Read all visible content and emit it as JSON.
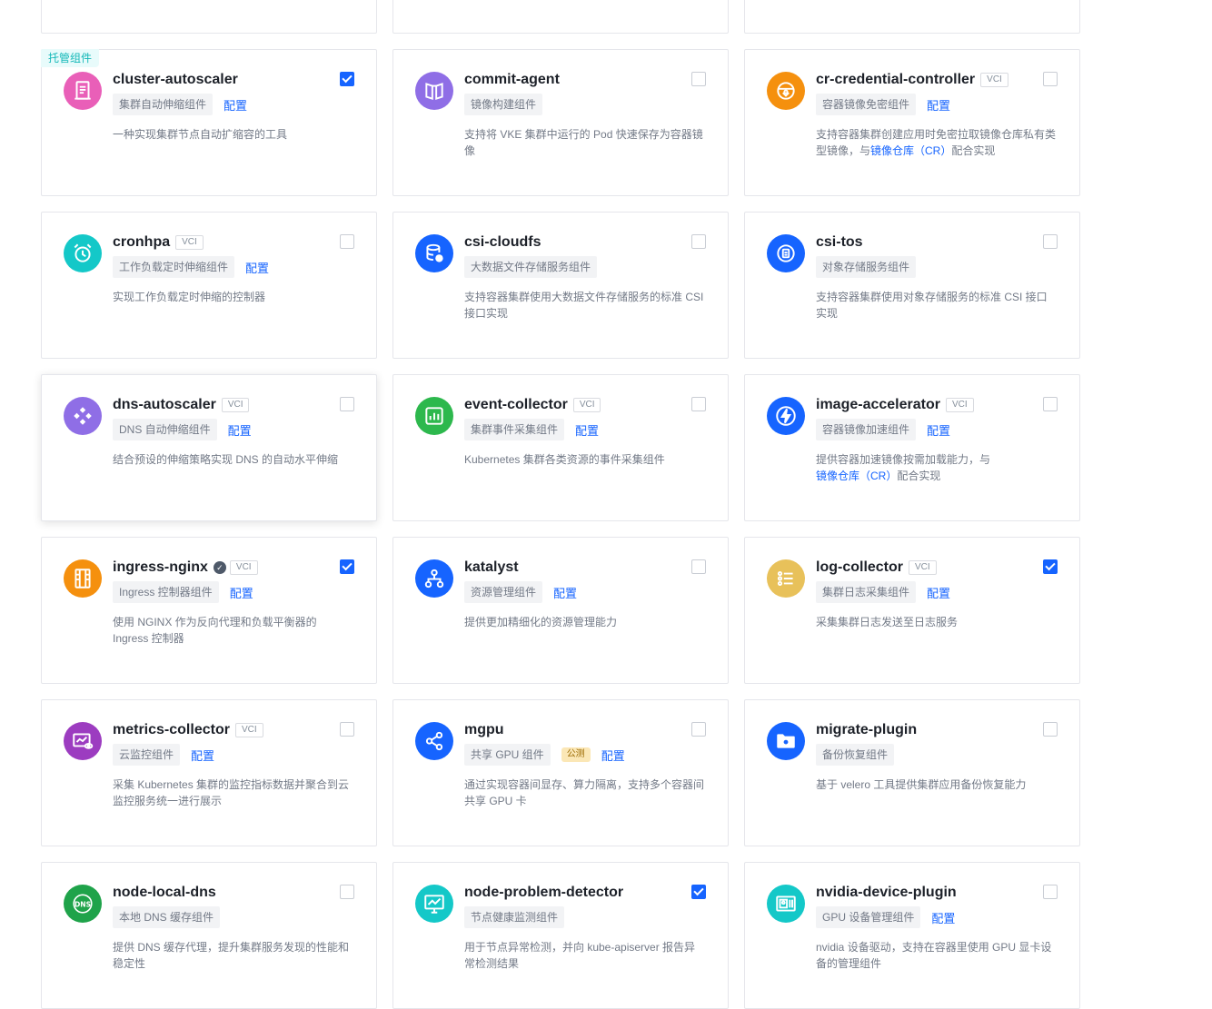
{
  "managed_tag": "托管组件",
  "vci_label": "VCI",
  "config_label": "配置",
  "cards": [
    {
      "title": "cluster-autoscaler",
      "vci": false,
      "verified": false,
      "tag": "集群自动伸缩组件",
      "beta": "",
      "config": true,
      "checked": true,
      "managed": true,
      "desc": "一种实现集群节点自动扩缩容的工具",
      "desc_link": "",
      "desc_after": "",
      "icon": "document-icon",
      "color": "#e95fb8",
      "hovered": false
    },
    {
      "title": "commit-agent",
      "vci": false,
      "verified": false,
      "tag": "镜像构建组件",
      "beta": "",
      "config": false,
      "checked": false,
      "managed": false,
      "desc": "支持将 VKE 集群中运行的 Pod 快速保存为容器镜像",
      "desc_link": "",
      "desc_after": "",
      "icon": "book-icon",
      "color": "#8f6ee6",
      "hovered": false
    },
    {
      "title": "cr-credential-controller",
      "vci": true,
      "verified": false,
      "tag": "容器镜像免密组件",
      "beta": "",
      "config": true,
      "checked": false,
      "managed": false,
      "desc": "支持容器集群创建应用时免密拉取镜像仓库私有类型镜像，与",
      "desc_link": "镜像仓库（CR）",
      "desc_after": "配合实现",
      "icon": "steering-icon",
      "color": "#f5900e",
      "hovered": false
    },
    {
      "title": "cronhpa",
      "vci": true,
      "verified": false,
      "tag": "工作负载定时伸缩组件",
      "beta": "",
      "config": true,
      "checked": false,
      "managed": false,
      "desc": "实现工作负载定时伸缩的控制器",
      "desc_link": "",
      "desc_after": "",
      "icon": "alarm-clock-icon",
      "color": "#14c8c8",
      "hovered": false
    },
    {
      "title": "csi-cloudfs",
      "vci": false,
      "verified": false,
      "tag": "大数据文件存储服务组件",
      "beta": "",
      "config": false,
      "checked": false,
      "managed": false,
      "desc": "支持容器集群使用大数据文件存储服务的标准 CSI 接口实现",
      "desc_link": "",
      "desc_after": "",
      "icon": "database-icon",
      "color": "#1664ff",
      "hovered": false
    },
    {
      "title": "csi-tos",
      "vci": false,
      "verified": false,
      "tag": "对象存储服务组件",
      "beta": "",
      "config": false,
      "checked": false,
      "managed": false,
      "desc": "支持容器集群使用对象存储服务的标准 CSI 接口实现",
      "desc_link": "",
      "desc_after": "",
      "icon": "object-storage-icon",
      "color": "#1664ff",
      "hovered": false
    },
    {
      "title": "dns-autoscaler",
      "vci": true,
      "verified": false,
      "tag": "DNS 自动伸缩组件",
      "beta": "",
      "config": true,
      "checked": false,
      "managed": false,
      "desc": "结合预设的伸缩策略实现 DNS 的自动水平伸缩",
      "desc_link": "",
      "desc_after": "",
      "icon": "diamond-grid-icon",
      "color": "#8f6ee6",
      "hovered": true
    },
    {
      "title": "event-collector",
      "vci": true,
      "verified": false,
      "tag": "集群事件采集组件",
      "beta": "",
      "config": true,
      "checked": false,
      "managed": false,
      "desc": "Kubernetes 集群各类资源的事件采集组件",
      "desc_link": "",
      "desc_after": "",
      "icon": "chart-board-icon",
      "color": "#2db84d",
      "hovered": false
    },
    {
      "title": "image-accelerator",
      "vci": true,
      "verified": false,
      "tag": "容器镜像加速组件",
      "beta": "",
      "config": true,
      "checked": false,
      "managed": false,
      "desc": "提供容器加速镜像按需加载能力，与",
      "desc_link": "镜像仓库（CR）",
      "desc_after": "配合实现",
      "icon": "lightning-icon",
      "color": "#1664ff",
      "hovered": false
    },
    {
      "title": "ingress-nginx",
      "vci": true,
      "verified": true,
      "tag": "Ingress 控制器组件",
      "beta": "",
      "config": true,
      "checked": true,
      "managed": false,
      "desc": "使用 NGINX 作为反向代理和负载平衡器的 Ingress 控制器",
      "desc_link": "",
      "desc_after": "",
      "icon": "film-icon",
      "color": "#f5900e",
      "hovered": false
    },
    {
      "title": "katalyst",
      "vci": false,
      "verified": false,
      "tag": "资源管理组件",
      "beta": "",
      "config": true,
      "checked": false,
      "managed": false,
      "desc": "提供更加精细化的资源管理能力",
      "desc_link": "",
      "desc_after": "",
      "icon": "hierarchy-icon",
      "color": "#1664ff",
      "hovered": false
    },
    {
      "title": "log-collector",
      "vci": true,
      "verified": false,
      "tag": "集群日志采集组件",
      "beta": "",
      "config": true,
      "checked": true,
      "managed": false,
      "desc": "采集集群日志发送至日志服务",
      "desc_link": "",
      "desc_after": "",
      "icon": "list-icon",
      "color": "#e8c15a",
      "hovered": false
    },
    {
      "title": "metrics-collector",
      "vci": true,
      "verified": false,
      "tag": "云监控组件",
      "beta": "",
      "config": true,
      "checked": false,
      "managed": false,
      "desc": "采集 Kubernetes 集群的监控指标数据并聚合到云监控服务统一进行展示",
      "desc_link": "",
      "desc_after": "",
      "icon": "monitor-eye-icon",
      "color": "#9c3cc0",
      "hovered": false
    },
    {
      "title": "mgpu",
      "vci": false,
      "verified": false,
      "tag": "共享 GPU 组件",
      "beta": "公测",
      "config": true,
      "checked": false,
      "managed": false,
      "desc": "通过实现容器间显存、算力隔离，支持多个容器间共享 GPU 卡",
      "desc_link": "",
      "desc_after": "",
      "icon": "share-nodes-icon",
      "color": "#1664ff",
      "hovered": false
    },
    {
      "title": "migrate-plugin",
      "vci": false,
      "verified": false,
      "tag": "备份恢复组件",
      "beta": "",
      "config": false,
      "checked": false,
      "managed": false,
      "desc": "基于 velero 工具提供集群应用备份恢复能力",
      "desc_link": "",
      "desc_after": "",
      "icon": "folder-cloud-icon",
      "color": "#1664ff",
      "hovered": false
    },
    {
      "title": "node-local-dns",
      "vci": false,
      "verified": false,
      "tag": "本地 DNS 缓存组件",
      "beta": "",
      "config": false,
      "checked": false,
      "managed": false,
      "desc": "提供 DNS 缓存代理，提升集群服务发现的性能和稳定性",
      "desc_link": "",
      "desc_after": "",
      "icon": "dns-globe-icon",
      "color": "#1fa34a",
      "hovered": false
    },
    {
      "title": "node-problem-detector",
      "vci": false,
      "verified": false,
      "tag": "节点健康监测组件",
      "beta": "",
      "config": false,
      "checked": true,
      "managed": false,
      "desc": "用于节点异常检测，并向 kube-apiserver 报告异常检测结果",
      "desc_link": "",
      "desc_after": "",
      "icon": "monitor-chart-icon",
      "color": "#14c8c8",
      "hovered": false
    },
    {
      "title": "nvidia-device-plugin",
      "vci": false,
      "verified": false,
      "tag": "GPU 设备管理组件",
      "beta": "",
      "config": true,
      "checked": false,
      "managed": false,
      "desc": "nvidia 设备驱动，支持在容器里使用 GPU 显卡设备的管理组件",
      "desc_link": "",
      "desc_after": "",
      "icon": "gpu-card-icon",
      "color": "#14c8c8",
      "hovered": false
    }
  ]
}
